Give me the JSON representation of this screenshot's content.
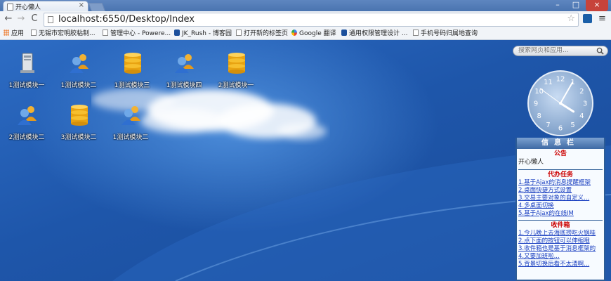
{
  "browser": {
    "tab_title": "开心懒人",
    "tab_close": "×",
    "window_min": "–",
    "window_max": "□",
    "window_close": "×",
    "nav_back": "←",
    "nav_forward": "→",
    "nav_reload": "C",
    "url": "localhost:6550/Desktop/Index",
    "star": "☆",
    "menu": "≡"
  },
  "bookmarks": [
    {
      "label": "应用",
      "icon": "apps-grid-icon"
    },
    {
      "label": "无锡市宏明胶粘制...",
      "icon": "page-icon"
    },
    {
      "label": "管理中心 - Powere...",
      "icon": "page-icon"
    },
    {
      "label": "JK_Rush - 博客园",
      "icon": "k-logo-icon"
    },
    {
      "label": "打开新的标签页",
      "icon": "page-icon"
    },
    {
      "label": "Google 翻译",
      "icon": "google-icon"
    },
    {
      "label": "通用权限管理设计 ...",
      "icon": "k-logo-icon"
    },
    {
      "label": "手机号码归属地查询",
      "icon": "page-icon"
    }
  ],
  "desktop_icons": [
    {
      "label": "1测试模块一",
      "icon": "computer-icon"
    },
    {
      "label": "1测试模块二",
      "icon": "users-icon"
    },
    {
      "label": "1测试模块三",
      "icon": "database-icon"
    },
    {
      "label": "1测试模块四",
      "icon": "users-icon"
    },
    {
      "label": "2测试模块一",
      "icon": "database-icon"
    },
    {
      "label": "2测试模块二",
      "icon": "users-icon"
    },
    {
      "label": "3测试模块二",
      "icon": "database-icon"
    },
    {
      "label": "1测试模块二",
      "icon": "users-icon"
    }
  ],
  "search": {
    "placeholder": "搜索网页和应用..."
  },
  "clock": {
    "hour": 4,
    "minute": 5,
    "second": 51,
    "numerals": [
      "12",
      "1",
      "2",
      "3",
      "4",
      "5",
      "6",
      "7",
      "8",
      "9",
      "10",
      "11"
    ]
  },
  "infobar": {
    "title": "信息栏",
    "notice_title": "公告",
    "notice_text": "开心懒人",
    "todo_title": "代办任务",
    "todo_items": [
      "1.基于Ajax的消息提醒框架",
      "2.桌面快捷方式设置",
      "3.交易主要对象的自定义...",
      "4.多桌面切换",
      "5.基于Ajax的在线IM"
    ],
    "inbox_title": "收件箱",
    "inbox_items": [
      "1.今儿晚上去海底捞吃火锅哇",
      "2.点下面的按钮可以伸缩哦",
      "3.收件箱也是基于消息框架的",
      "4.又要加班啦...",
      "5.背景切换后看不太清啊..."
    ]
  },
  "colors": {
    "desktop": "#1f56aa",
    "info_border": "#2c5c96",
    "section_title": "#cc0000",
    "link": "#1a3fc0"
  }
}
